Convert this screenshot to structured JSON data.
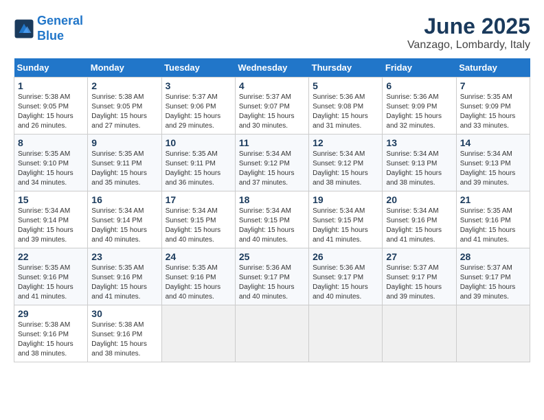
{
  "header": {
    "logo_line1": "General",
    "logo_line2": "Blue",
    "month": "June 2025",
    "location": "Vanzago, Lombardy, Italy"
  },
  "columns": [
    "Sunday",
    "Monday",
    "Tuesday",
    "Wednesday",
    "Thursday",
    "Friday",
    "Saturday"
  ],
  "weeks": [
    [
      {
        "day": "1",
        "info": "Sunrise: 5:38 AM\nSunset: 9:05 PM\nDaylight: 15 hours\nand 26 minutes."
      },
      {
        "day": "2",
        "info": "Sunrise: 5:38 AM\nSunset: 9:05 PM\nDaylight: 15 hours\nand 27 minutes."
      },
      {
        "day": "3",
        "info": "Sunrise: 5:37 AM\nSunset: 9:06 PM\nDaylight: 15 hours\nand 29 minutes."
      },
      {
        "day": "4",
        "info": "Sunrise: 5:37 AM\nSunset: 9:07 PM\nDaylight: 15 hours\nand 30 minutes."
      },
      {
        "day": "5",
        "info": "Sunrise: 5:36 AM\nSunset: 9:08 PM\nDaylight: 15 hours\nand 31 minutes."
      },
      {
        "day": "6",
        "info": "Sunrise: 5:36 AM\nSunset: 9:09 PM\nDaylight: 15 hours\nand 32 minutes."
      },
      {
        "day": "7",
        "info": "Sunrise: 5:35 AM\nSunset: 9:09 PM\nDaylight: 15 hours\nand 33 minutes."
      }
    ],
    [
      {
        "day": "8",
        "info": "Sunrise: 5:35 AM\nSunset: 9:10 PM\nDaylight: 15 hours\nand 34 minutes."
      },
      {
        "day": "9",
        "info": "Sunrise: 5:35 AM\nSunset: 9:11 PM\nDaylight: 15 hours\nand 35 minutes."
      },
      {
        "day": "10",
        "info": "Sunrise: 5:35 AM\nSunset: 9:11 PM\nDaylight: 15 hours\nand 36 minutes."
      },
      {
        "day": "11",
        "info": "Sunrise: 5:34 AM\nSunset: 9:12 PM\nDaylight: 15 hours\nand 37 minutes."
      },
      {
        "day": "12",
        "info": "Sunrise: 5:34 AM\nSunset: 9:12 PM\nDaylight: 15 hours\nand 38 minutes."
      },
      {
        "day": "13",
        "info": "Sunrise: 5:34 AM\nSunset: 9:13 PM\nDaylight: 15 hours\nand 38 minutes."
      },
      {
        "day": "14",
        "info": "Sunrise: 5:34 AM\nSunset: 9:13 PM\nDaylight: 15 hours\nand 39 minutes."
      }
    ],
    [
      {
        "day": "15",
        "info": "Sunrise: 5:34 AM\nSunset: 9:14 PM\nDaylight: 15 hours\nand 39 minutes."
      },
      {
        "day": "16",
        "info": "Sunrise: 5:34 AM\nSunset: 9:14 PM\nDaylight: 15 hours\nand 40 minutes."
      },
      {
        "day": "17",
        "info": "Sunrise: 5:34 AM\nSunset: 9:15 PM\nDaylight: 15 hours\nand 40 minutes."
      },
      {
        "day": "18",
        "info": "Sunrise: 5:34 AM\nSunset: 9:15 PM\nDaylight: 15 hours\nand 40 minutes."
      },
      {
        "day": "19",
        "info": "Sunrise: 5:34 AM\nSunset: 9:15 PM\nDaylight: 15 hours\nand 41 minutes."
      },
      {
        "day": "20",
        "info": "Sunrise: 5:34 AM\nSunset: 9:16 PM\nDaylight: 15 hours\nand 41 minutes."
      },
      {
        "day": "21",
        "info": "Sunrise: 5:35 AM\nSunset: 9:16 PM\nDaylight: 15 hours\nand 41 minutes."
      }
    ],
    [
      {
        "day": "22",
        "info": "Sunrise: 5:35 AM\nSunset: 9:16 PM\nDaylight: 15 hours\nand 41 minutes."
      },
      {
        "day": "23",
        "info": "Sunrise: 5:35 AM\nSunset: 9:16 PM\nDaylight: 15 hours\nand 41 minutes."
      },
      {
        "day": "24",
        "info": "Sunrise: 5:35 AM\nSunset: 9:16 PM\nDaylight: 15 hours\nand 40 minutes."
      },
      {
        "day": "25",
        "info": "Sunrise: 5:36 AM\nSunset: 9:17 PM\nDaylight: 15 hours\nand 40 minutes."
      },
      {
        "day": "26",
        "info": "Sunrise: 5:36 AM\nSunset: 9:17 PM\nDaylight: 15 hours\nand 40 minutes."
      },
      {
        "day": "27",
        "info": "Sunrise: 5:37 AM\nSunset: 9:17 PM\nDaylight: 15 hours\nand 39 minutes."
      },
      {
        "day": "28",
        "info": "Sunrise: 5:37 AM\nSunset: 9:17 PM\nDaylight: 15 hours\nand 39 minutes."
      }
    ],
    [
      {
        "day": "29",
        "info": "Sunrise: 5:38 AM\nSunset: 9:16 PM\nDaylight: 15 hours\nand 38 minutes."
      },
      {
        "day": "30",
        "info": "Sunrise: 5:38 AM\nSunset: 9:16 PM\nDaylight: 15 hours\nand 38 minutes."
      },
      null,
      null,
      null,
      null,
      null
    ]
  ]
}
